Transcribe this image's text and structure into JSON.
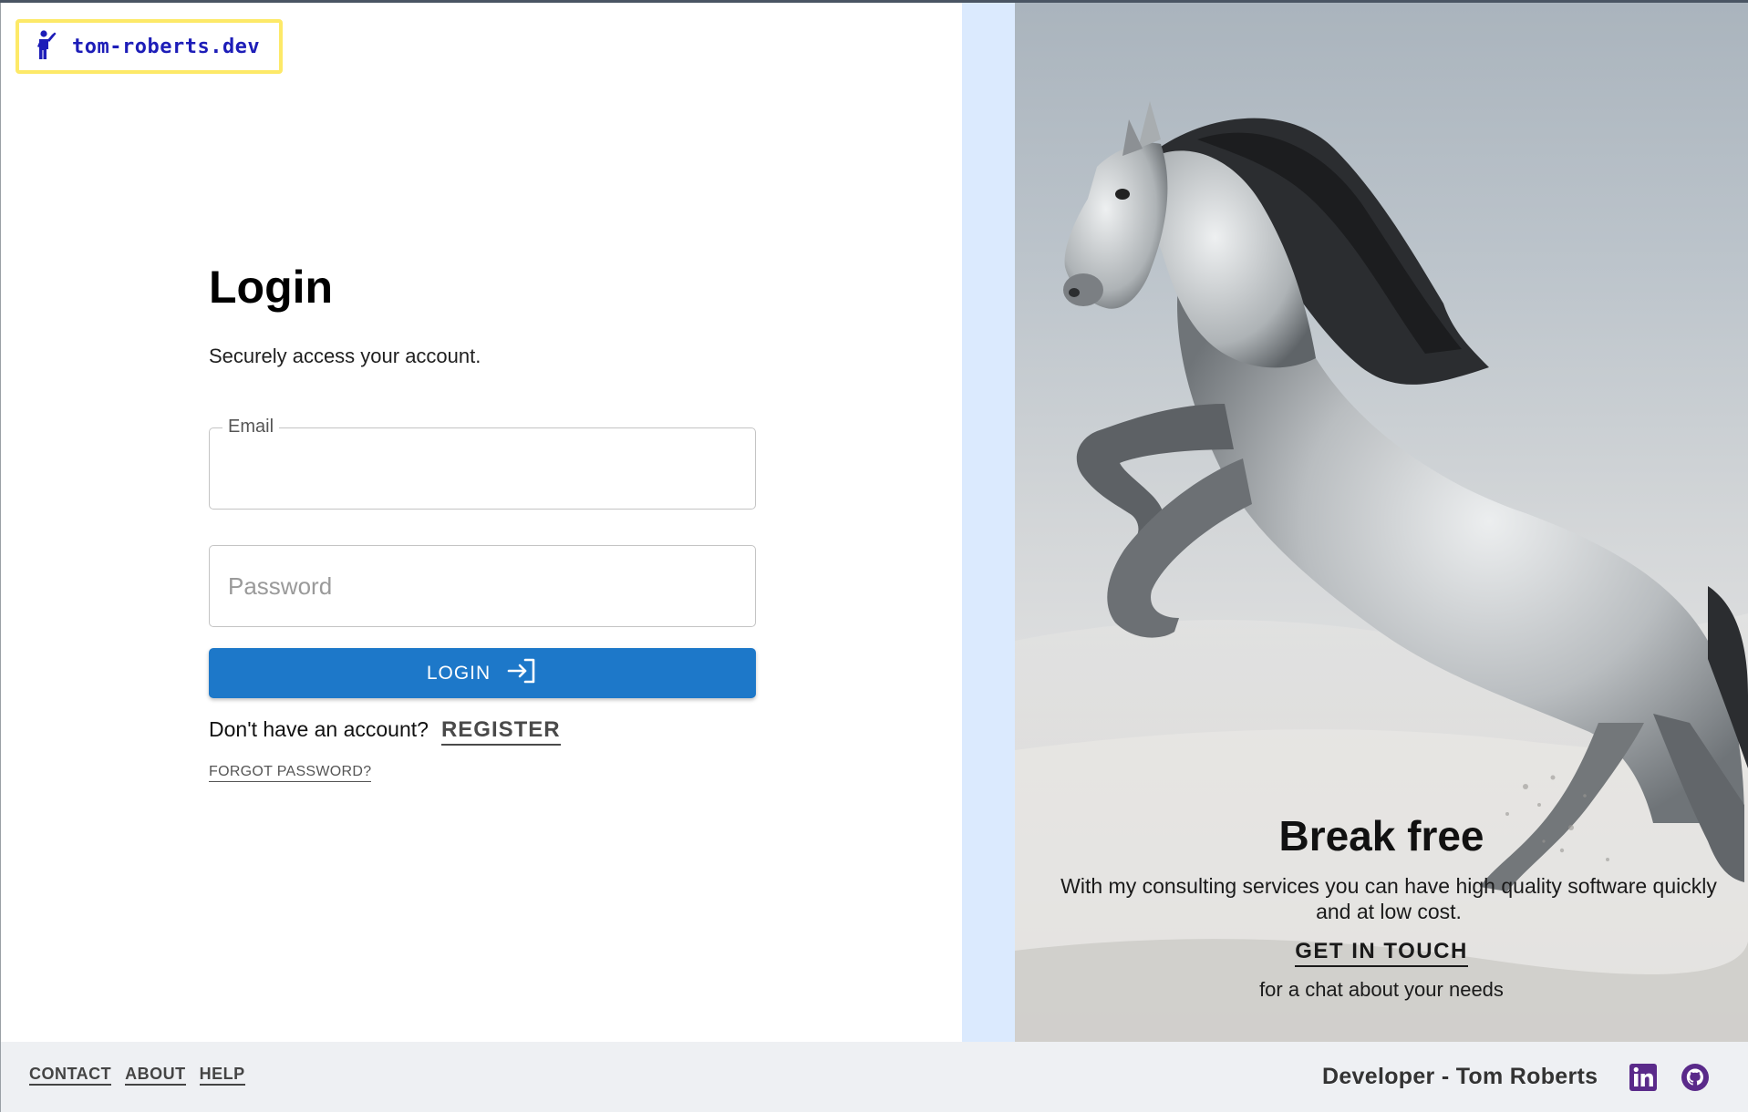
{
  "brand": {
    "logo_text": "tom-roberts.dev",
    "logo_color": "#1d1db8",
    "logo_border_color": "#fde968"
  },
  "login": {
    "title": "Login",
    "subtitle": "Securely access your account.",
    "email_label": "Email",
    "email_value": "",
    "password_placeholder": "Password",
    "password_value": "",
    "button_label": "LOGIN",
    "button_color": "#1d78c9",
    "no_account_text": "Don't have an account?",
    "register_label": "REGISTER",
    "forgot_label": "FORGOT PASSWORD?"
  },
  "hero": {
    "title": "Break free",
    "text": "With my consulting services you can have high quality software quickly and at low cost.",
    "cta_label": "GET IN TOUCH",
    "cta_subtext": "for a chat about your needs",
    "image": "rearing-white-horse"
  },
  "footer": {
    "links": [
      "CONTACT",
      "ABOUT",
      "HELP"
    ],
    "credit": "Developer - Tom Roberts",
    "social_icons": [
      "linkedin-icon",
      "github-icon"
    ],
    "social_color": "#5a2a8a"
  },
  "colors": {
    "side_strip": "#dbeafe",
    "footer_bg": "#eef0f3"
  }
}
